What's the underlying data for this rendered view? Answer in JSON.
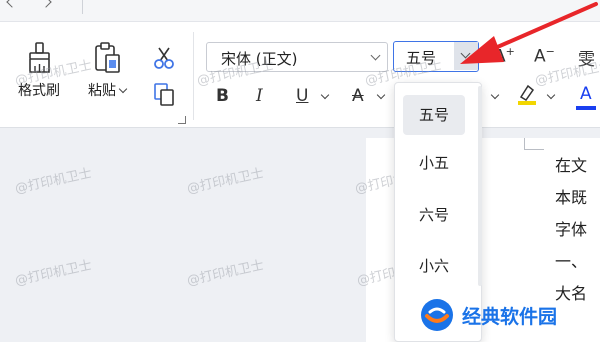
{
  "ribbon": {
    "format_painter_label": "格式刷",
    "paste_label": "粘贴",
    "font_name": "宋体 (正文)",
    "font_size": "五号",
    "grow_font_label": "A",
    "shrink_font_label": "A",
    "phonetic_label": "雯",
    "bold_label": "B",
    "italic_label": "I",
    "underline_label": "U",
    "strike_label": "A",
    "font_color_label": "A"
  },
  "size_dropdown": {
    "items": [
      "五号",
      "小五",
      "六号",
      "小六"
    ],
    "selected": "五号"
  },
  "document": {
    "lines": [
      "在文",
      "本既",
      "字体",
      "一、",
      "大名"
    ]
  },
  "watermark": "@打印机卫士",
  "logo": {
    "label": "经典软件园"
  },
  "colors": {
    "accent_blue": "#3f74e6",
    "arrow_red": "#e8262a",
    "highlight_yellow": "#f2d600",
    "font_color_blue": "#1a3ff0"
  }
}
